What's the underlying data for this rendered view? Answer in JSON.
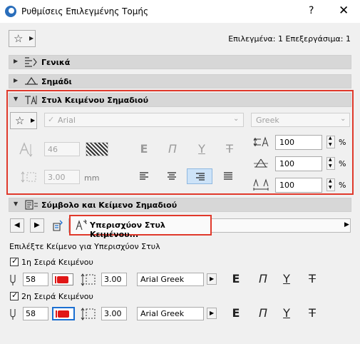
{
  "window": {
    "title": "Ρυθμίσεις Επιλεγμένης Τομής",
    "help": "?",
    "close": "✕"
  },
  "header": {
    "selection_info": "Επιλεγμένα: 1 Επεξεργάσιμα: 1"
  },
  "sections": {
    "general": "Γενικά",
    "marker": "Σημάδι",
    "text_style": "Στυλ Κειμένου Σημαδιού",
    "symbol_text": "Σύμβολο και Κείμενο Σημαδιού"
  },
  "text_style": {
    "font": "Arial",
    "script": "Greek",
    "font_size": "46",
    "spacing": "3.00",
    "spacing_unit": "mm",
    "width_factor": "100",
    "slant": "100",
    "spacing_factor": "100",
    "percent": "%"
  },
  "override": {
    "button_label": "Υπερισχύον Στυλ Κειμένου...",
    "prompt": "Επιλέξτε Κείμενο για Υπερισχύον Στυλ"
  },
  "rows": [
    {
      "label": "1η Σειρά Κειμένου",
      "size": "58",
      "spacing": "3.00",
      "font": "Arial Greek"
    },
    {
      "label": "2η Σειρά Κειμένου",
      "size": "58",
      "spacing": "3.00",
      "font": "Arial Greek"
    }
  ],
  "colors": {
    "highlight": "#e0392b",
    "pen": "#e01616",
    "accent": "#1b6fd1"
  }
}
